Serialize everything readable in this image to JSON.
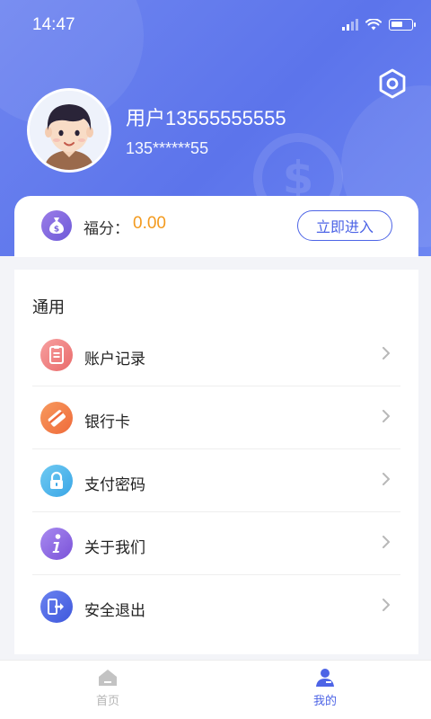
{
  "status_bar": {
    "time": "14:47"
  },
  "profile": {
    "username": "用户13555555555",
    "phone_masked": "135******55"
  },
  "points": {
    "label": "福分",
    "separator": "：",
    "value": "0.00",
    "enter_label": "立即进入"
  },
  "menu": {
    "section_title": "通用",
    "items": [
      {
        "label": "账户记录",
        "icon": "account-record-icon",
        "color": "#f08a8a"
      },
      {
        "label": "银行卡",
        "icon": "bank-card-icon",
        "color": "#f47a45"
      },
      {
        "label": "支付密码",
        "icon": "lock-icon",
        "color": "#47b4ea"
      },
      {
        "label": "关于我们",
        "icon": "info-icon",
        "color": "#8c63e0"
      },
      {
        "label": "安全退出",
        "icon": "logout-icon",
        "color": "#4c66e4"
      }
    ]
  },
  "tabbar": {
    "tabs": [
      {
        "label": "首页",
        "icon": "home-icon",
        "active": false
      },
      {
        "label": "我的",
        "icon": "profile-icon",
        "active": true
      }
    ]
  },
  "colors": {
    "header_gradient_start": "#6f86f0",
    "header_gradient_end": "#5c74eb",
    "accent_blue": "#4d64e6",
    "points_orange": "#f39a1e",
    "tab_inactive": "#b5b5b5"
  }
}
